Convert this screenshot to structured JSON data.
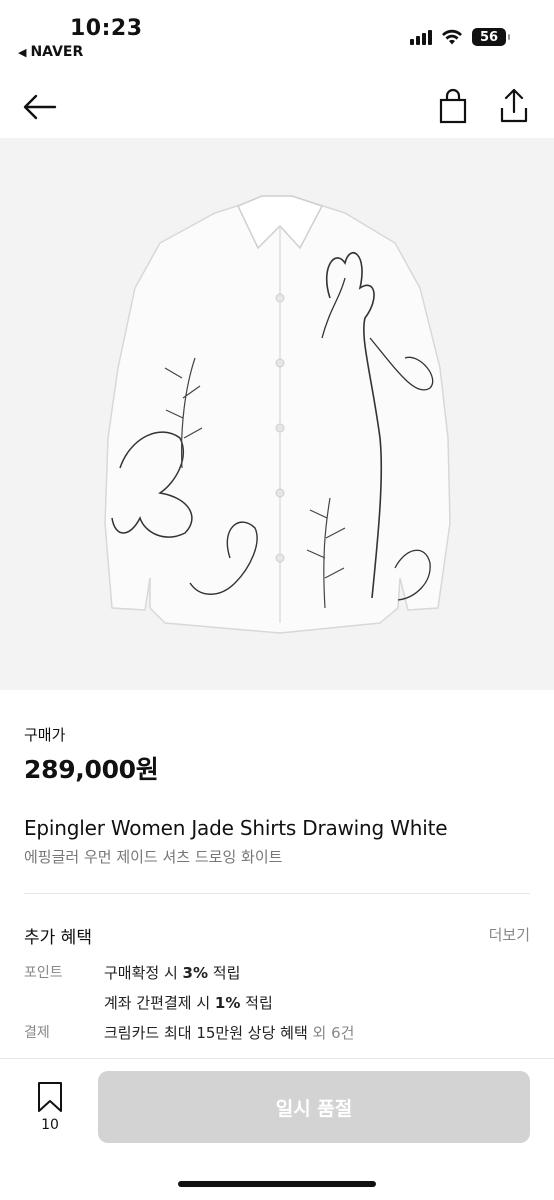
{
  "status_bar": {
    "time": "10:23",
    "back_app": "NAVER",
    "battery": "56",
    "icons": [
      "signal-icon",
      "wifi-icon",
      "battery-icon"
    ]
  },
  "nav": {
    "icons": [
      "back-arrow-icon",
      "shopping-bag-icon",
      "share-icon"
    ]
  },
  "product": {
    "price_label": "구매가",
    "price": "289,000원",
    "name": "Epingler Women Jade Shirts Drawing White",
    "name_ko": "에핑글러 우먼 제이드 셔츠 드로잉 화이트"
  },
  "benefits": {
    "title": "추가 혜택",
    "more": "더보기",
    "point_label": "포인트",
    "point_line1_pre": "구매확정 시 ",
    "point_line1_bold": "3%",
    "point_line1_post": " 적립",
    "point_line2_pre": "계좌 간편결제 시 ",
    "point_line2_bold": "1%",
    "point_line2_post": " 적립",
    "payment_label": "결제",
    "payment_line": "크림카드 최대 15만원 상당 혜택",
    "payment_extra": " 외 6건"
  },
  "bottom": {
    "wish_count": "10",
    "buy_label": "일시 품절"
  }
}
